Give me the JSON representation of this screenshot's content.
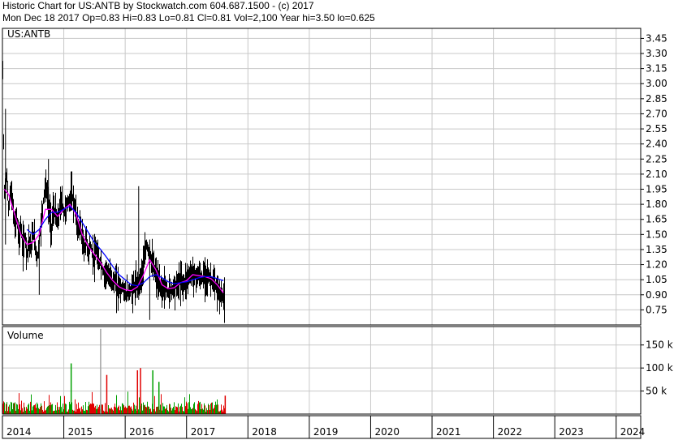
{
  "header": {
    "line1": "Historic Chart for US:ANTB by Stockwatch.com 604.687.1500 - (c) 2017",
    "line2": "Mon Dec 18 2017   Op=0.83  Hi=0.83  Lo=0.81  Cl=0.81  Vol=2,100  Year hi=3.50  lo=0.625"
  },
  "colors": {
    "grid": "#c8c8c8",
    "price": "#000000",
    "ma_short": "#ff00ff",
    "ma_long": "#0000ff",
    "vol_up": "#00a000",
    "vol_down": "#e00000",
    "vol_spike": "#a0a0a0"
  },
  "chart_data": [
    {
      "type": "line",
      "title": "US:ANTB",
      "y_axis_side": "right",
      "ylim": [
        0.6,
        3.55
      ],
      "y_ticks": [
        "3.45",
        "3.30",
        "3.15",
        "3.00",
        "2.85",
        "2.70",
        "2.55",
        "2.40",
        "2.25",
        "2.10",
        "1.95",
        "1.80",
        "1.65",
        "1.50",
        "1.35",
        "1.20",
        "1.05",
        "0.90",
        "0.75"
      ],
      "x_ticks": [
        "2014",
        "2015",
        "2016",
        "2017",
        "2018",
        "2019",
        "2020",
        "2021",
        "2022",
        "2023",
        "2024"
      ],
      "xlim": [
        2014.0,
        2024.4
      ],
      "grid": true,
      "series": [],
      "price_points": [
        [
          2014.0,
          3.45
        ],
        [
          2014.03,
          1.9
        ],
        [
          2014.07,
          2.1
        ],
        [
          2014.1,
          1.75
        ],
        [
          2014.13,
          1.95
        ],
        [
          2014.17,
          1.8
        ],
        [
          2014.2,
          1.55
        ],
        [
          2014.23,
          1.7
        ],
        [
          2014.27,
          1.45
        ],
        [
          2014.3,
          1.6
        ],
        [
          2014.33,
          1.35
        ],
        [
          2014.37,
          1.5
        ],
        [
          2014.4,
          1.3
        ],
        [
          2014.43,
          1.45
        ],
        [
          2014.47,
          1.35
        ],
        [
          2014.5,
          1.55
        ],
        [
          2014.53,
          1.4
        ],
        [
          2014.57,
          1.25
        ],
        [
          2014.6,
          1.45
        ],
        [
          2014.63,
          1.6
        ],
        [
          2014.67,
          1.85
        ],
        [
          2014.7,
          2.0
        ],
        [
          2014.73,
          1.9
        ],
        [
          2014.77,
          1.7
        ],
        [
          2014.8,
          1.55
        ],
        [
          2014.83,
          1.75
        ],
        [
          2014.87,
          1.7
        ],
        [
          2014.9,
          1.6
        ],
        [
          2014.93,
          1.75
        ],
        [
          2014.97,
          1.85
        ],
        [
          2015.0,
          1.7
        ],
        [
          2015.05,
          1.8
        ],
        [
          2015.1,
          1.85
        ],
        [
          2015.13,
          1.9
        ],
        [
          2015.17,
          1.8
        ],
        [
          2015.2,
          1.7
        ],
        [
          2015.23,
          1.55
        ],
        [
          2015.27,
          1.6
        ],
        [
          2015.3,
          1.45
        ],
        [
          2015.33,
          1.35
        ],
        [
          2015.37,
          1.45
        ],
        [
          2015.4,
          1.3
        ],
        [
          2015.43,
          1.4
        ],
        [
          2015.47,
          1.3
        ],
        [
          2015.5,
          1.25
        ],
        [
          2015.53,
          1.35
        ],
        [
          2015.57,
          1.2
        ],
        [
          2015.6,
          1.25
        ],
        [
          2015.63,
          1.15
        ],
        [
          2015.67,
          1.1
        ],
        [
          2015.7,
          1.15
        ],
        [
          2015.73,
          1.05
        ],
        [
          2015.77,
          1.1
        ],
        [
          2015.8,
          1.0
        ],
        [
          2015.83,
          1.05
        ],
        [
          2015.87,
          0.95
        ],
        [
          2015.9,
          1.0
        ],
        [
          2015.93,
          0.95
        ],
        [
          2015.97,
          0.98
        ],
        [
          2016.0,
          0.9
        ],
        [
          2016.05,
          0.92
        ],
        [
          2016.1,
          0.95
        ],
        [
          2016.15,
          0.98
        ],
        [
          2016.2,
          1.0
        ],
        [
          2016.25,
          1.05
        ],
        [
          2016.3,
          1.2
        ],
        [
          2016.35,
          1.4
        ],
        [
          2016.4,
          1.3
        ],
        [
          2016.45,
          1.2
        ],
        [
          2016.5,
          1.1
        ],
        [
          2016.55,
          1.0
        ],
        [
          2016.6,
          0.95
        ],
        [
          2016.65,
          0.98
        ],
        [
          2016.7,
          0.92
        ],
        [
          2016.75,
          0.95
        ],
        [
          2016.8,
          0.98
        ],
        [
          2016.85,
          1.0
        ],
        [
          2016.9,
          1.05
        ],
        [
          2016.95,
          1.0
        ],
        [
          2017.0,
          1.05
        ],
        [
          2017.05,
          1.1
        ],
        [
          2017.1,
          1.12
        ],
        [
          2017.15,
          1.08
        ],
        [
          2017.2,
          1.1
        ],
        [
          2017.25,
          1.05
        ],
        [
          2017.3,
          1.1
        ],
        [
          2017.35,
          1.08
        ],
        [
          2017.4,
          1.05
        ],
        [
          2017.45,
          1.0
        ],
        [
          2017.5,
          0.95
        ],
        [
          2017.55,
          0.9
        ],
        [
          2017.6,
          0.88
        ],
        [
          2017.63,
          0.81
        ]
      ],
      "ma_short_points": [
        [
          2014.03,
          1.95
        ],
        [
          2014.1,
          1.9
        ],
        [
          2014.2,
          1.7
        ],
        [
          2014.3,
          1.5
        ],
        [
          2014.4,
          1.4
        ],
        [
          2014.5,
          1.42
        ],
        [
          2014.6,
          1.5
        ],
        [
          2014.7,
          1.75
        ],
        [
          2014.8,
          1.75
        ],
        [
          2014.9,
          1.68
        ],
        [
          2015.0,
          1.75
        ],
        [
          2015.1,
          1.8
        ],
        [
          2015.2,
          1.7
        ],
        [
          2015.3,
          1.5
        ],
        [
          2015.4,
          1.38
        ],
        [
          2015.5,
          1.3
        ],
        [
          2015.6,
          1.22
        ],
        [
          2015.7,
          1.12
        ],
        [
          2015.8,
          1.04
        ],
        [
          2015.9,
          0.98
        ],
        [
          2016.0,
          0.95
        ],
        [
          2016.1,
          0.94
        ],
        [
          2016.2,
          0.98
        ],
        [
          2016.3,
          1.1
        ],
        [
          2016.4,
          1.25
        ],
        [
          2016.5,
          1.15
        ],
        [
          2016.6,
          1.0
        ],
        [
          2016.7,
          0.96
        ],
        [
          2016.8,
          0.97
        ],
        [
          2016.9,
          1.02
        ],
        [
          2017.0,
          1.04
        ],
        [
          2017.1,
          1.1
        ],
        [
          2017.2,
          1.09
        ],
        [
          2017.3,
          1.08
        ],
        [
          2017.4,
          1.06
        ],
        [
          2017.5,
          1.0
        ],
        [
          2017.6,
          0.92
        ]
      ],
      "ma_long_points": [
        [
          2014.4,
          1.55
        ],
        [
          2014.5,
          1.5
        ],
        [
          2014.6,
          1.55
        ],
        [
          2014.7,
          1.65
        ],
        [
          2014.8,
          1.72
        ],
        [
          2014.9,
          1.72
        ],
        [
          2015.0,
          1.75
        ],
        [
          2015.1,
          1.78
        ],
        [
          2015.2,
          1.72
        ],
        [
          2015.3,
          1.62
        ],
        [
          2015.4,
          1.52
        ],
        [
          2015.5,
          1.42
        ],
        [
          2015.6,
          1.35
        ],
        [
          2015.7,
          1.27
        ],
        [
          2015.8,
          1.18
        ],
        [
          2015.9,
          1.1
        ],
        [
          2016.0,
          1.05
        ],
        [
          2016.1,
          1.0
        ],
        [
          2016.2,
          0.99
        ],
        [
          2016.3,
          1.02
        ],
        [
          2016.4,
          1.08
        ],
        [
          2016.5,
          1.1
        ],
        [
          2016.6,
          1.07
        ],
        [
          2016.7,
          1.03
        ],
        [
          2016.8,
          1.01
        ],
        [
          2016.9,
          1.02
        ],
        [
          2017.0,
          1.03
        ],
        [
          2017.1,
          1.05
        ],
        [
          2017.2,
          1.07
        ],
        [
          2017.3,
          1.08
        ],
        [
          2017.4,
          1.08
        ],
        [
          2017.5,
          1.06
        ],
        [
          2017.6,
          1.04
        ]
      ]
    },
    {
      "type": "bar",
      "title": "Volume",
      "y_axis_side": "right",
      "ylim": [
        0,
        190000
      ],
      "y_ticks": [
        "150 k",
        "100 k",
        "50 k"
      ],
      "y_tick_values": [
        150000,
        100000,
        50000
      ],
      "xlim": [
        2014.0,
        2024.4
      ],
      "spikes": [
        {
          "x": 2015.12,
          "value": 110000,
          "up": true
        },
        {
          "x": 2015.6,
          "value": 185000,
          "up": null
        },
        {
          "x": 2015.7,
          "value": 85000,
          "up": false
        },
        {
          "x": 2016.2,
          "value": 95000,
          "up": false
        },
        {
          "x": 2016.25,
          "value": 100000,
          "up": false
        },
        {
          "x": 2016.45,
          "value": 95000,
          "up": true
        },
        {
          "x": 2016.55,
          "value": 70000,
          "up": true
        },
        {
          "x": 2017.63,
          "value": 40000,
          "up": false
        }
      ]
    }
  ]
}
